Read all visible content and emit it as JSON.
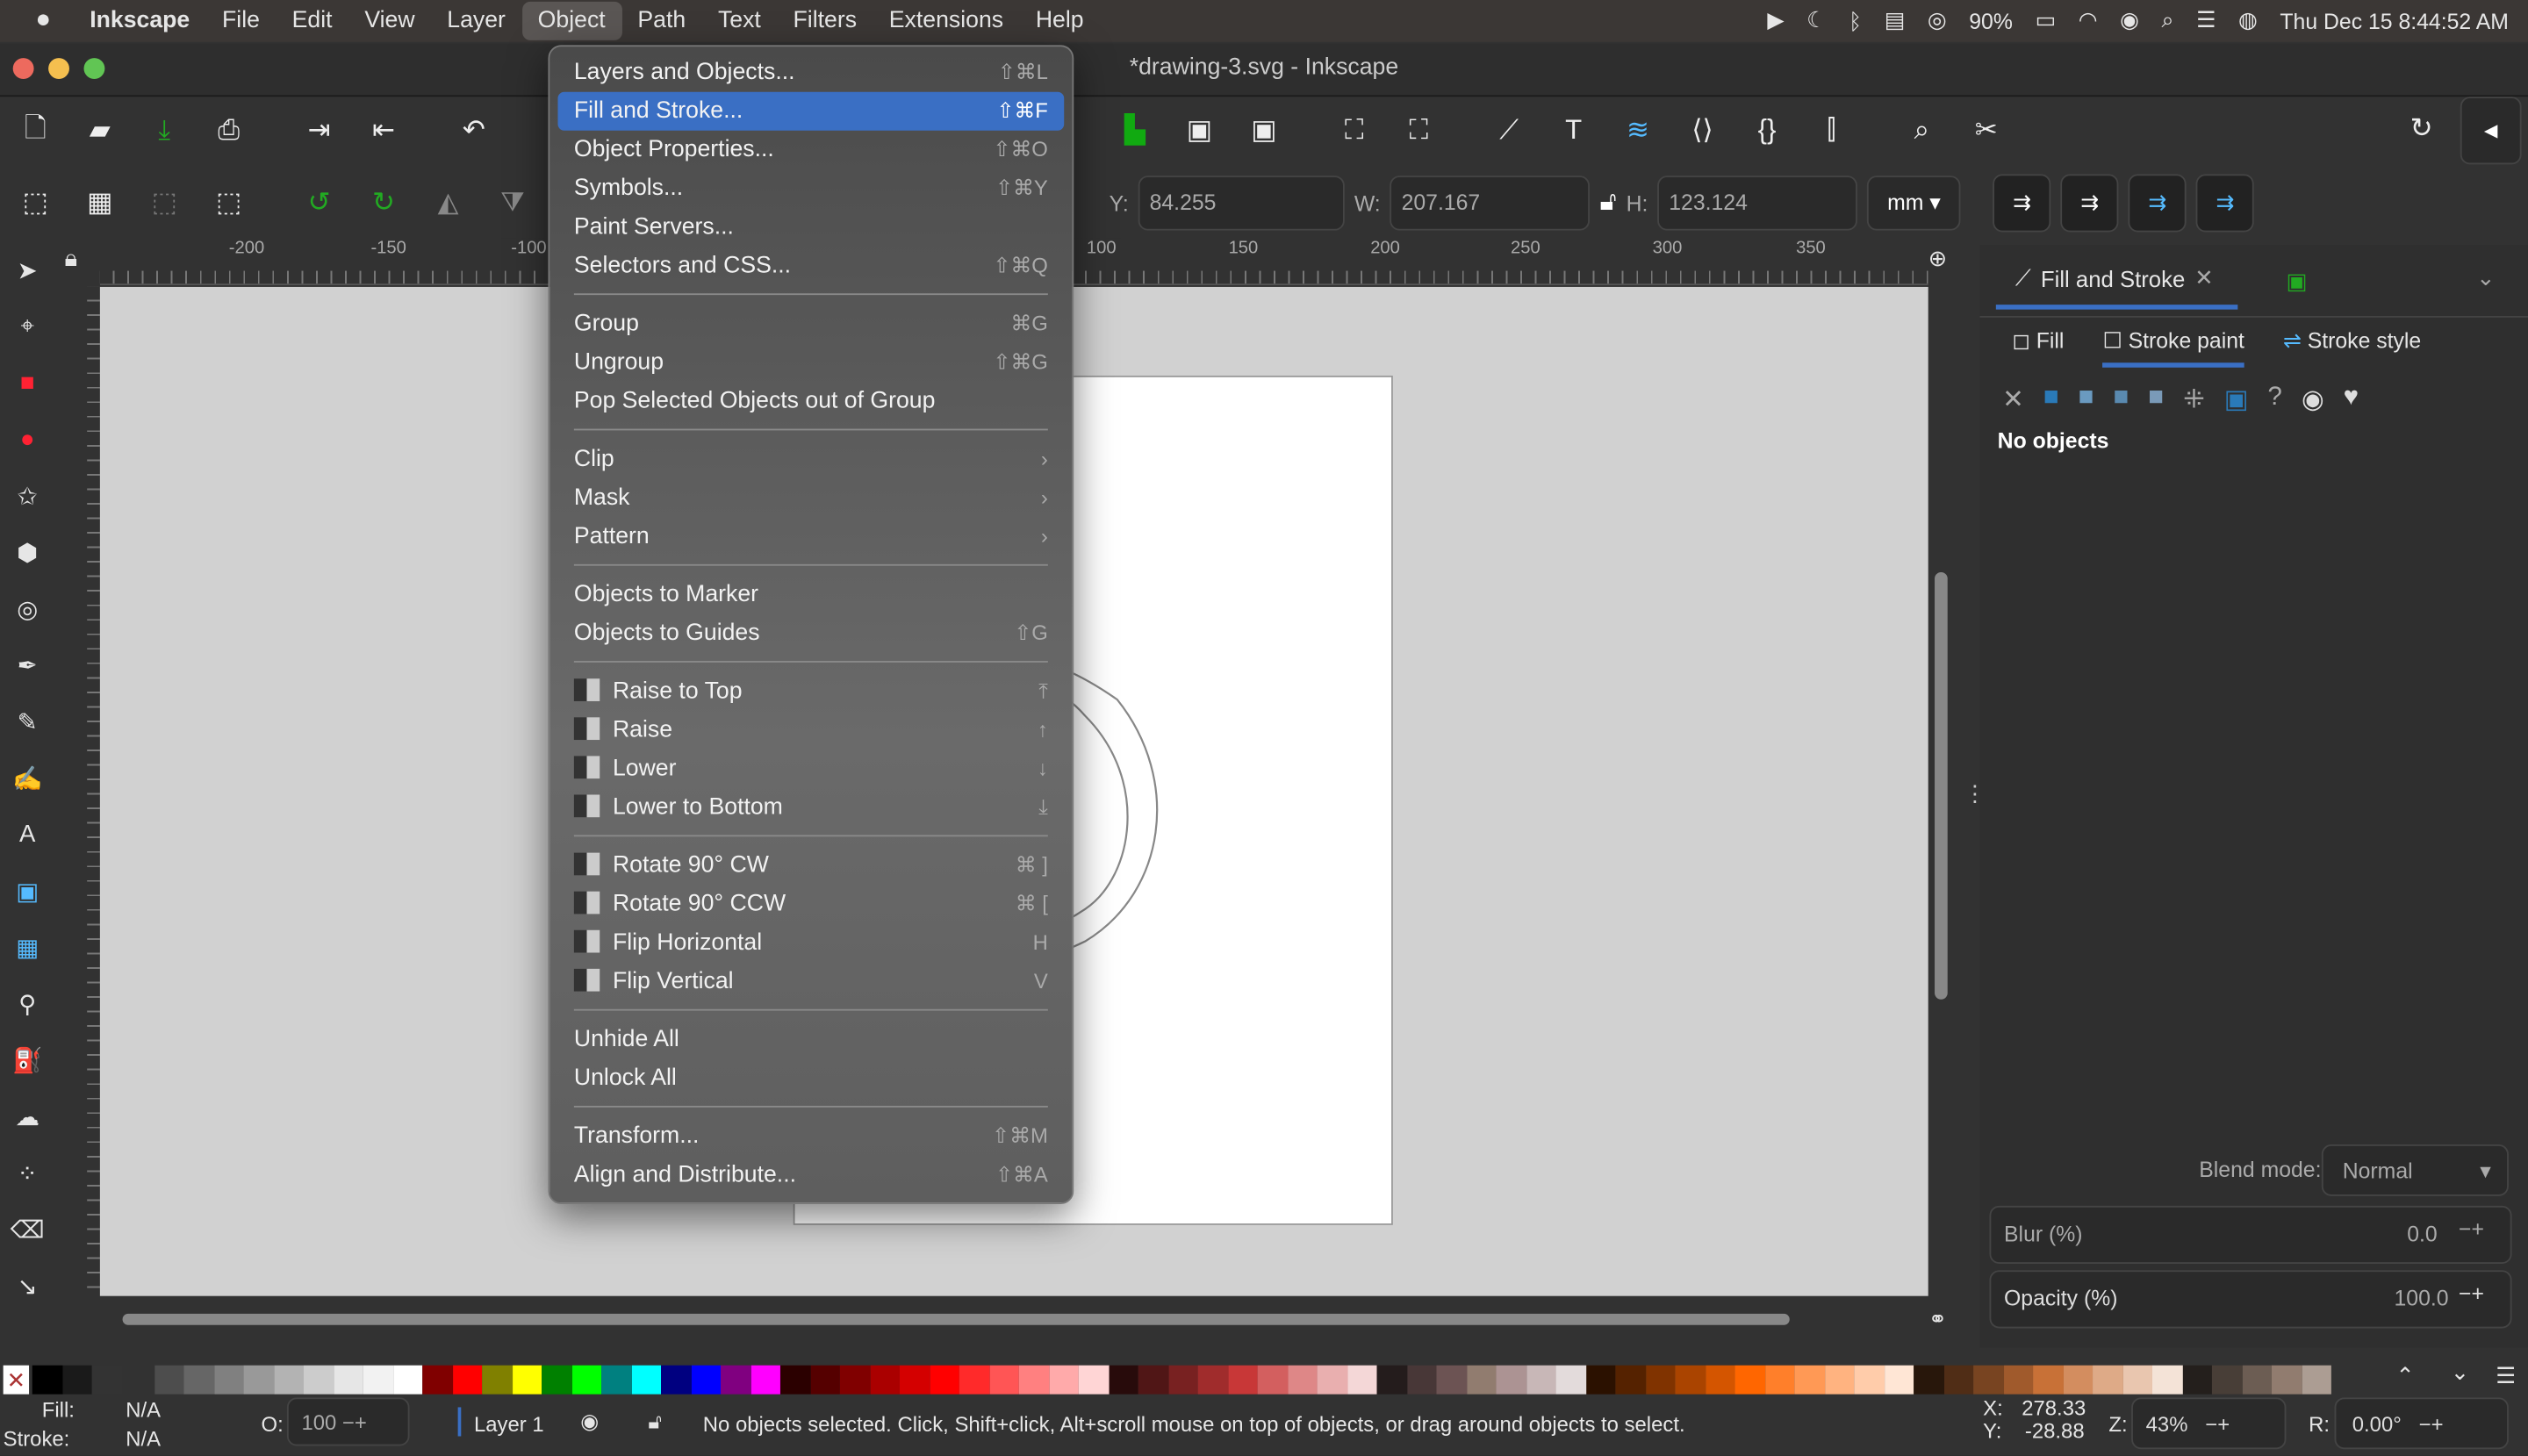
{
  "menubar": {
    "app": "Inkscape",
    "items": [
      "File",
      "Edit",
      "View",
      "Layer",
      "Object",
      "Path",
      "Text",
      "Filters",
      "Extensions",
      "Help"
    ],
    "battery": "90%",
    "datetime": "Thu Dec 15  8:44:52 AM"
  },
  "window": {
    "title": "*drawing-3.svg - Inkscape"
  },
  "toolbar": {
    "y_label": "Y:",
    "y_value": "84.255",
    "w_label": "W:",
    "w_value": "207.167",
    "h_label": "H:",
    "h_value": "123.124",
    "unit": "mm"
  },
  "ruler": {
    "ticks": [
      "-200",
      "-150",
      "-100",
      "100",
      "150",
      "200",
      "250",
      "300",
      "350"
    ]
  },
  "object_menu": {
    "items": [
      {
        "label": "Layers and Objects...",
        "shortcut": "⇧⌘L"
      },
      {
        "label": "Fill and Stroke...",
        "shortcut": "⇧⌘F",
        "highlighted": true
      },
      {
        "label": "Object Properties...",
        "shortcut": "⇧⌘O"
      },
      {
        "label": "Symbols...",
        "shortcut": "⇧⌘Y"
      },
      {
        "label": "Paint Servers...",
        "shortcut": ""
      },
      {
        "label": "Selectors and CSS...",
        "shortcut": "⇧⌘Q"
      },
      {
        "label": "Group",
        "shortcut": "⌘G"
      },
      {
        "label": "Ungroup",
        "shortcut": "⇧⌘G"
      },
      {
        "label": "Pop Selected Objects out of Group",
        "shortcut": ""
      },
      {
        "label": "Clip",
        "shortcut": "›"
      },
      {
        "label": "Mask",
        "shortcut": "›"
      },
      {
        "label": "Pattern",
        "shortcut": "›"
      },
      {
        "label": "Objects to Marker",
        "shortcut": ""
      },
      {
        "label": "Objects to Guides",
        "shortcut": "⇧G"
      },
      {
        "label": "Raise to Top",
        "shortcut": "⤒"
      },
      {
        "label": "Raise",
        "shortcut": "↑"
      },
      {
        "label": "Lower",
        "shortcut": "↓"
      },
      {
        "label": "Lower to Bottom",
        "shortcut": "⤓"
      },
      {
        "label": "Rotate 90° CW",
        "shortcut": "⌘ ]"
      },
      {
        "label": "Rotate 90° CCW",
        "shortcut": "⌘ ["
      },
      {
        "label": "Flip Horizontal",
        "shortcut": "H"
      },
      {
        "label": "Flip Vertical",
        "shortcut": "V"
      },
      {
        "label": "Unhide All",
        "shortcut": ""
      },
      {
        "label": "Unlock All",
        "shortcut": ""
      },
      {
        "label": "Transform...",
        "shortcut": "⇧⌘M"
      },
      {
        "label": "Align and Distribute...",
        "shortcut": "⇧⌘A"
      }
    ]
  },
  "dock": {
    "tab": "Fill and Stroke",
    "subtabs": [
      "Fill",
      "Stroke paint",
      "Stroke style"
    ],
    "no_objects": "No objects",
    "blend_label": "Blend mode:",
    "blend_value": "Normal",
    "blur_label": "Blur (%)",
    "blur_value": "0.0",
    "opacity_label": "Opacity (%)",
    "opacity_value": "100.0"
  },
  "palette": [
    "#000000",
    "#1a1a1a",
    "#333333",
    "#4d4d4d",
    "#666666",
    "#808080",
    "#999999",
    "#b3b3b3",
    "#cccccc",
    "#e6e6e6",
    "#f2f2f2",
    "#ffffff",
    "#800000",
    "#ff0000",
    "#808000",
    "#ffff00",
    "#008000",
    "#00ff00",
    "#008080",
    "#00ffff",
    "#000080",
    "#0000ff",
    "#800080",
    "#ff00ff",
    "#2b0000",
    "#550000",
    "#800000",
    "#aa0000",
    "#d40000",
    "#ff0000",
    "#ff2a2a",
    "#ff5555",
    "#ff8080",
    "#ffaaaa",
    "#ffd5d5",
    "#280b0b",
    "#501616",
    "#782121",
    "#a02c2c",
    "#c83737",
    "#d35f5f",
    "#de8787",
    "#e9afaf",
    "#f4d7d7",
    "#241c1c",
    "#483737",
    "#6c5353",
    "#917c6f",
    "#ac9393",
    "#c8b7b7",
    "#e3dbdb",
    "#2b1100",
    "#552200",
    "#803300",
    "#aa4400",
    "#d45500",
    "#ff6600",
    "#ff7f2a",
    "#ff9955",
    "#ffb380",
    "#ffccaa",
    "#ffe6d5",
    "#28170b",
    "#502d16",
    "#784421",
    "#a05a2c",
    "#c87137",
    "#d38d5f",
    "#deaa87",
    "#e9c6af",
    "#f4e3d7",
    "#241f1c",
    "#483e37",
    "#6c5d53",
    "#917c6f",
    "#ac9d93"
  ],
  "status": {
    "fill_label": "Fill:",
    "fill_value": "N/A",
    "stroke_label": "Stroke:",
    "stroke_value": "N/A",
    "opacity_label": "O:",
    "opacity_value": "100",
    "layer": "Layer 1",
    "message": "No objects selected. Click, Shift+click, Alt+scroll mouse on top of objects, or drag around objects to select.",
    "x_label": "X:",
    "x_value": "278.33",
    "y_label": "Y:",
    "y_value": "-28.88",
    "zoom_label": "Z:",
    "zoom_value": "43%",
    "rot_label": "R:",
    "rot_value": "0.00°"
  }
}
